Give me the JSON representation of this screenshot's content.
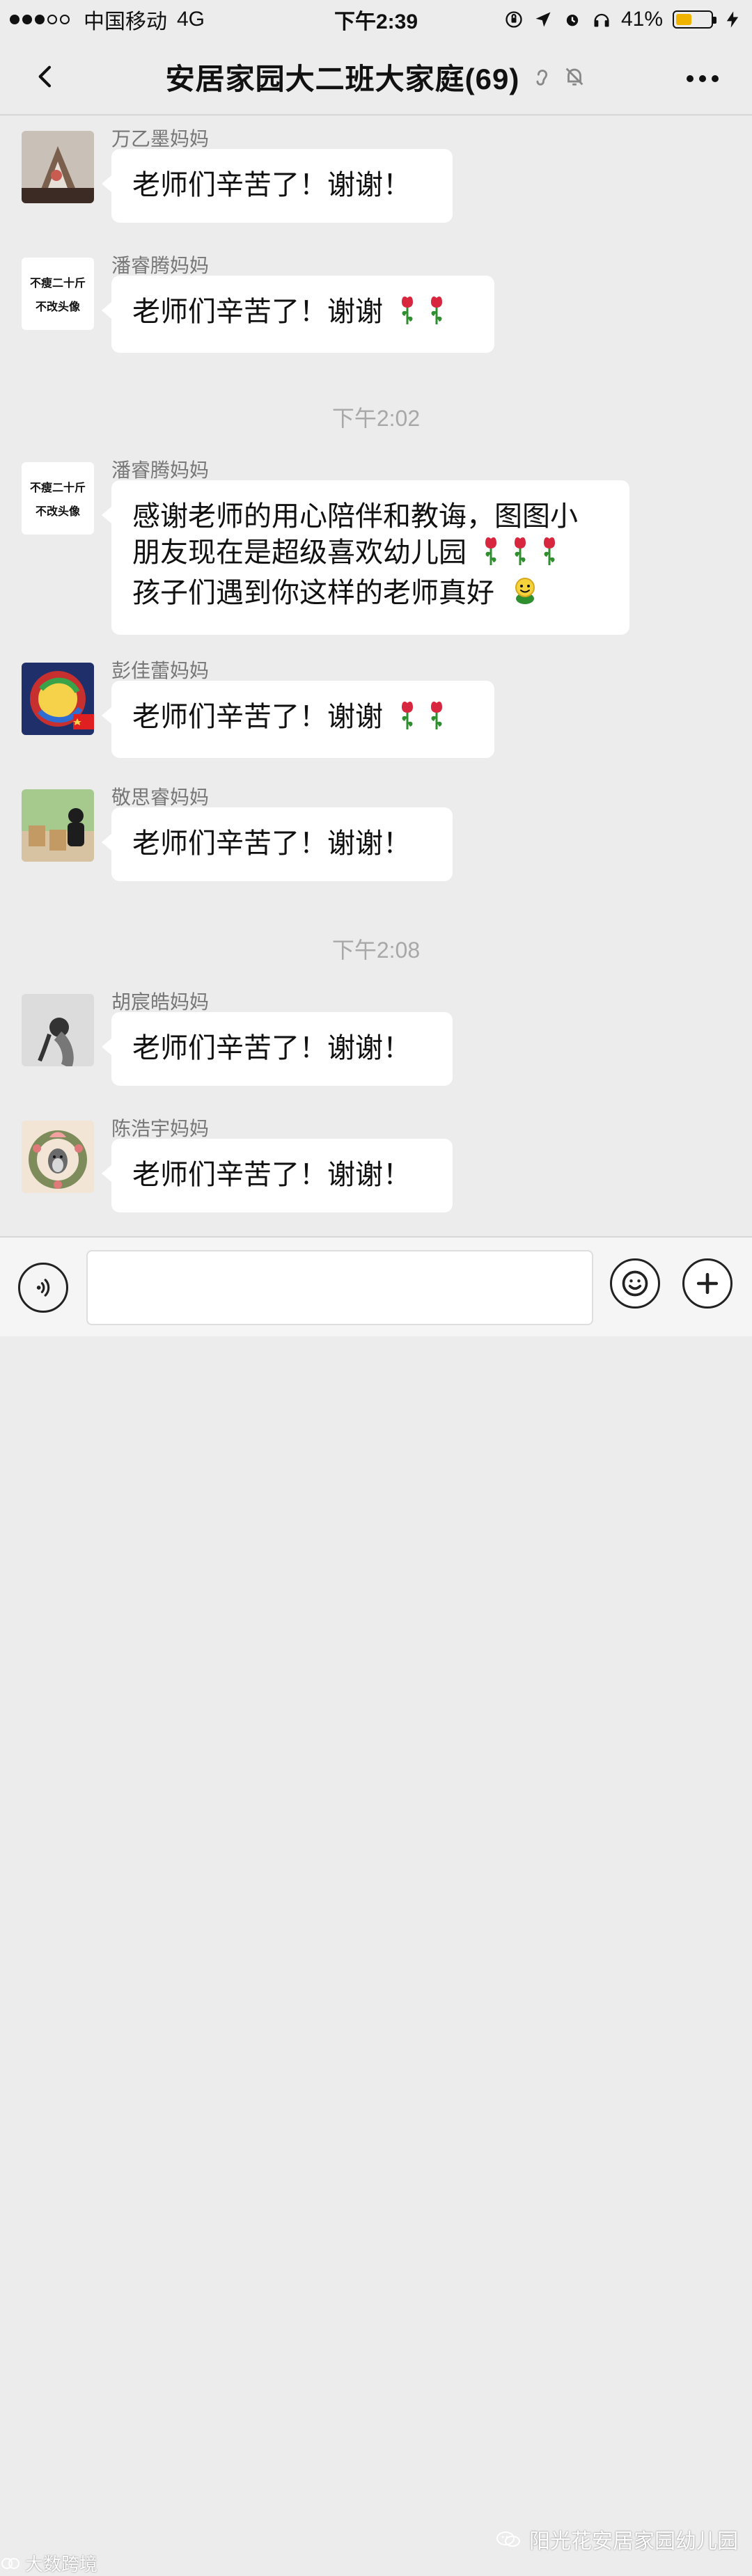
{
  "status_bar": {
    "carrier": "中国移动",
    "network": "4G",
    "time": "下午2:39",
    "battery": "41%",
    "battery_level": 0.41,
    "signal_dots": [
      1,
      1,
      1,
      0,
      0
    ]
  },
  "nav": {
    "title": "安居家园大二班大家庭(69)"
  },
  "chat": {
    "messages": [
      {
        "name": "万乙墨妈妈",
        "text": "老师们辛苦了！谢谢！",
        "emoji": []
      },
      {
        "name": "潘睿腾妈妈",
        "avatar_text_1": "不瘦二十斤",
        "avatar_text_2": "不改头像",
        "text": "老师们辛苦了！谢谢",
        "emoji": [
          "rose-icon",
          "rose-icon"
        ]
      },
      {
        "timestamp": "下午2:02"
      },
      {
        "name": "潘睿腾妈妈",
        "avatar_text_1": "不瘦二十斤",
        "avatar_text_2": "不改头像",
        "lines": [
          "感谢老师的用心陪伴和教诲，图图小",
          "朋友现在是超级喜欢幼儿园",
          "孩子们遇到你这样的老师真好"
        ],
        "emoji_line2": [
          "rose-icon",
          "rose-icon",
          "rose-icon"
        ],
        "emoji_line3": [
          "smile-icon"
        ]
      },
      {
        "name": "彭佳蕾妈妈",
        "text": "老师们辛苦了！谢谢",
        "emoji": [
          "rose-icon",
          "rose-icon"
        ]
      },
      {
        "name": "敬思睿妈妈",
        "text": "老师们辛苦了！谢谢！",
        "emoji": []
      },
      {
        "timestamp": "下午2:08"
      },
      {
        "name": "胡宸皓妈妈",
        "text": "老师们辛苦了！谢谢！",
        "emoji": []
      },
      {
        "name": "陈浩宇妈妈",
        "text": "老师们辛苦了！谢谢！",
        "emoji": []
      }
    ]
  },
  "input_bar": {
    "placeholder": ""
  },
  "watermarks": {
    "left": "大数跨境",
    "right": "阳光花安居家园幼儿园"
  },
  "colors": {
    "background": "#ececec",
    "bubble": "#ffffff",
    "battery": "#f0b400",
    "rose": "#d7263d"
  }
}
